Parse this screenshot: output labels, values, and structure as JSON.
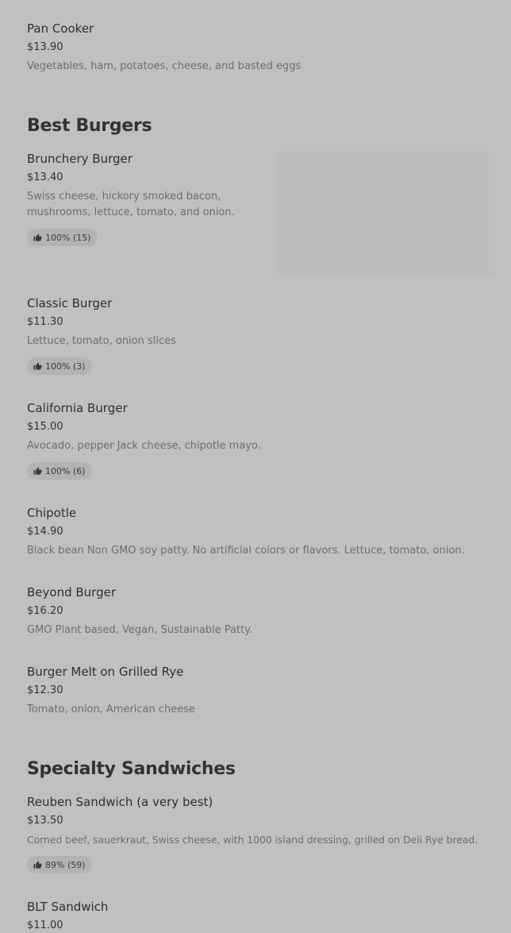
{
  "items_top": {
    "pan_cooker": {
      "name": "Pan Cooker",
      "price": "$13.90",
      "description": "Vegetables, ham, potatoes, cheese, and basted eggs"
    }
  },
  "sections": {
    "best_burgers": {
      "title": "Best Burgers",
      "items": [
        {
          "name": "Brunchery Burger",
          "price": "$13.40",
          "description": "Swiss cheese, hickory smoked bacon, mushrooms, lettuce, tomato, and onion.",
          "rating": "100% (15)"
        },
        {
          "name": "Classic Burger",
          "price": "$11.30",
          "description": "Lettuce, tomato, onion slices",
          "rating": "100% (3)"
        },
        {
          "name": "California Burger",
          "price": "$15.00",
          "description": "Avocado, pepper Jack cheese, chipotle mayo.",
          "rating": "100% (6)"
        },
        {
          "name": "Chipotle",
          "price": "$14.90",
          "description": "Black bean Non GMO soy patty. No artificial colors or flavors. Lettuce, tomato, onion."
        },
        {
          "name": "Beyond Burger",
          "price": "$16.20",
          "description": "GMO Plant based, Vegan, Sustainable Patty."
        },
        {
          "name": "Burger Melt on Grilled Rye",
          "price": "$12.30",
          "description": "Tomato, onion, American cheese"
        }
      ]
    },
    "specialty_sandwiches": {
      "title": "Specialty Sandwiches",
      "items": [
        {
          "name": "Reuben Sandwich (a very best)",
          "price": "$13.50",
          "description": "Corned beef, sauerkraut, Swiss cheese, with 1000 island dressing, grilled on Deli Rye bread.",
          "rating": "89% (59)"
        },
        {
          "name": "BLT Sandwich",
          "price": "$11.00"
        }
      ]
    }
  },
  "icons": {
    "rating_icon": "thumbs-up-icon"
  },
  "colors": {
    "page_background": "#c0c0c0",
    "text_primary": "#2e2e2e",
    "text_secondary": "#6e6e6e",
    "rating_pill": "#b3b3b3"
  }
}
